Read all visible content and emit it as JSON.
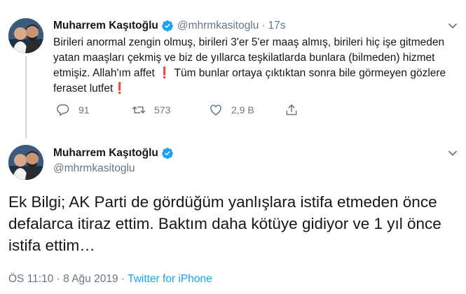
{
  "colors": {
    "text": "#14171a",
    "secondary": "#657786",
    "brand_blue": "#1da1f2",
    "exclamation_red": "#e0192b",
    "thread_line": "#ccd6dd"
  },
  "tweet1": {
    "name": "Muharrem Kaşıtoğlu",
    "handle": "@mhrmkasitoglu",
    "separator": "·",
    "time": "17s",
    "text_part1": "Birileri anormal zengin olmuş, birileri 3'er 5'er maaş almış, birileri hiç işe gitmeden yatan maaşları çekmiş ve biz de yıllarca teşkilatlarda bunlara (bilmeden) hizmet etmişiz. Allah'ım affet",
    "exclamation": "❗",
    "text_part2": " Tüm bunlar ortaya çıktıktan sonra bile görmeyen gözlere feraset lutfet",
    "replies": "91",
    "retweets": "573",
    "likes": "2,9 B",
    "icons": [
      "verified-badge-icon",
      "chevron-down-icon",
      "reply-icon",
      "retweet-icon",
      "heart-icon",
      "share-icon"
    ]
  },
  "tweet2": {
    "name": "Muharrem Kaşıtoğlu",
    "handle": "@mhrmkasitoglu",
    "text": "Ek Bilgi; AK Parti de gördüğüm yanlışlara istifa etmeden önce defalarca itiraz ettim. Baktım daha kötüye gidiyor ve 1 yıl önce istifa ettim…",
    "time": "ÖS 11:10",
    "meta_sep": " · ",
    "date": "8 Ağu 2019",
    "source": "Twitter for iPhone"
  }
}
